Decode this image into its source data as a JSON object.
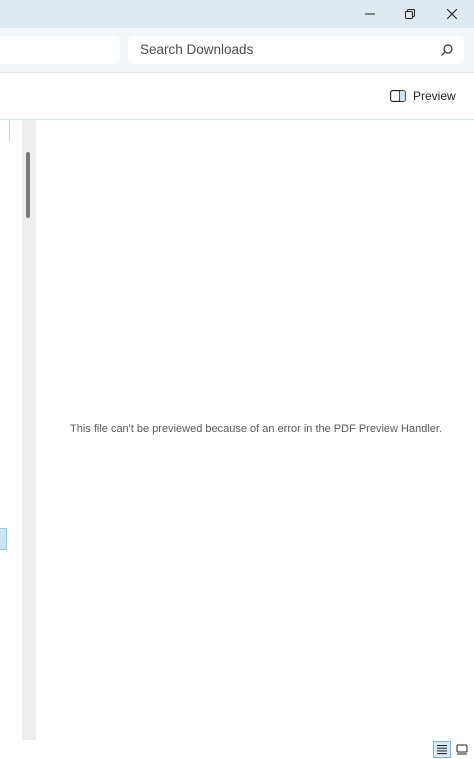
{
  "window_controls": {
    "minimize_icon": "minimize-icon",
    "restore_icon": "restore-icon",
    "close_icon": "close-icon"
  },
  "search": {
    "placeholder": "Search Downloads",
    "icon": "search-icon"
  },
  "command_bar": {
    "preview_label": "Preview",
    "preview_icon": "preview-pane-icon"
  },
  "preview_pane": {
    "message": "This file can't be previewed because of an error in the PDF Preview Handler."
  },
  "status_bar": {
    "view_details_icon": "details-view-icon",
    "view_tiles_icon": "large-icons-view-icon",
    "active_view": "details"
  },
  "colors": {
    "titlebar": "#dfe9ef",
    "accent": "#0067c0",
    "selection": "#cce4f7"
  }
}
